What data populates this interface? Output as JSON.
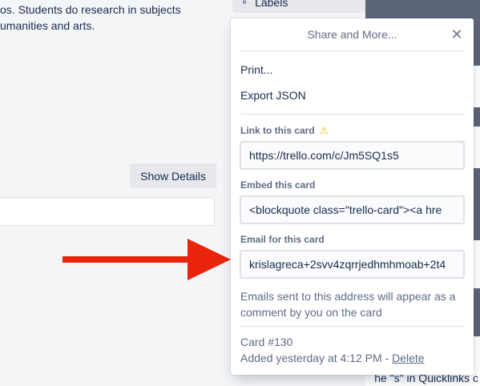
{
  "description": {
    "line1": "os. Students do research in subjects",
    "line2": "umanities and arts."
  },
  "show_details_label": "Show Details",
  "sidebar": {
    "labels_button": "Labels"
  },
  "popover": {
    "title": "Share and More...",
    "close_icon": "close-icon",
    "menu": {
      "print": "Print...",
      "export_json": "Export JSON"
    },
    "link": {
      "label": "Link to this card",
      "value": "https://trello.com/c/Jm5SQ1s5"
    },
    "embed": {
      "label": "Embed this card",
      "value": "<blockquote class=\"trello-card\"><a hre"
    },
    "email": {
      "label": "Email for this card",
      "value": "krislagreca+2svv4zqrrjedhmhmoab+2t4"
    },
    "email_hint": "Emails sent to this address will appear as a comment by you on the card",
    "card_number": "Card #130",
    "added_text": "Added yesterday at 4:12 PM - ",
    "delete_link": "Delete"
  },
  "right_panel_text": "he \"s\" in Quicklinks c",
  "colors": {
    "arrow": "#e8250c",
    "accent_icon": "#e6b800",
    "popover_bg": "#ffffff"
  }
}
